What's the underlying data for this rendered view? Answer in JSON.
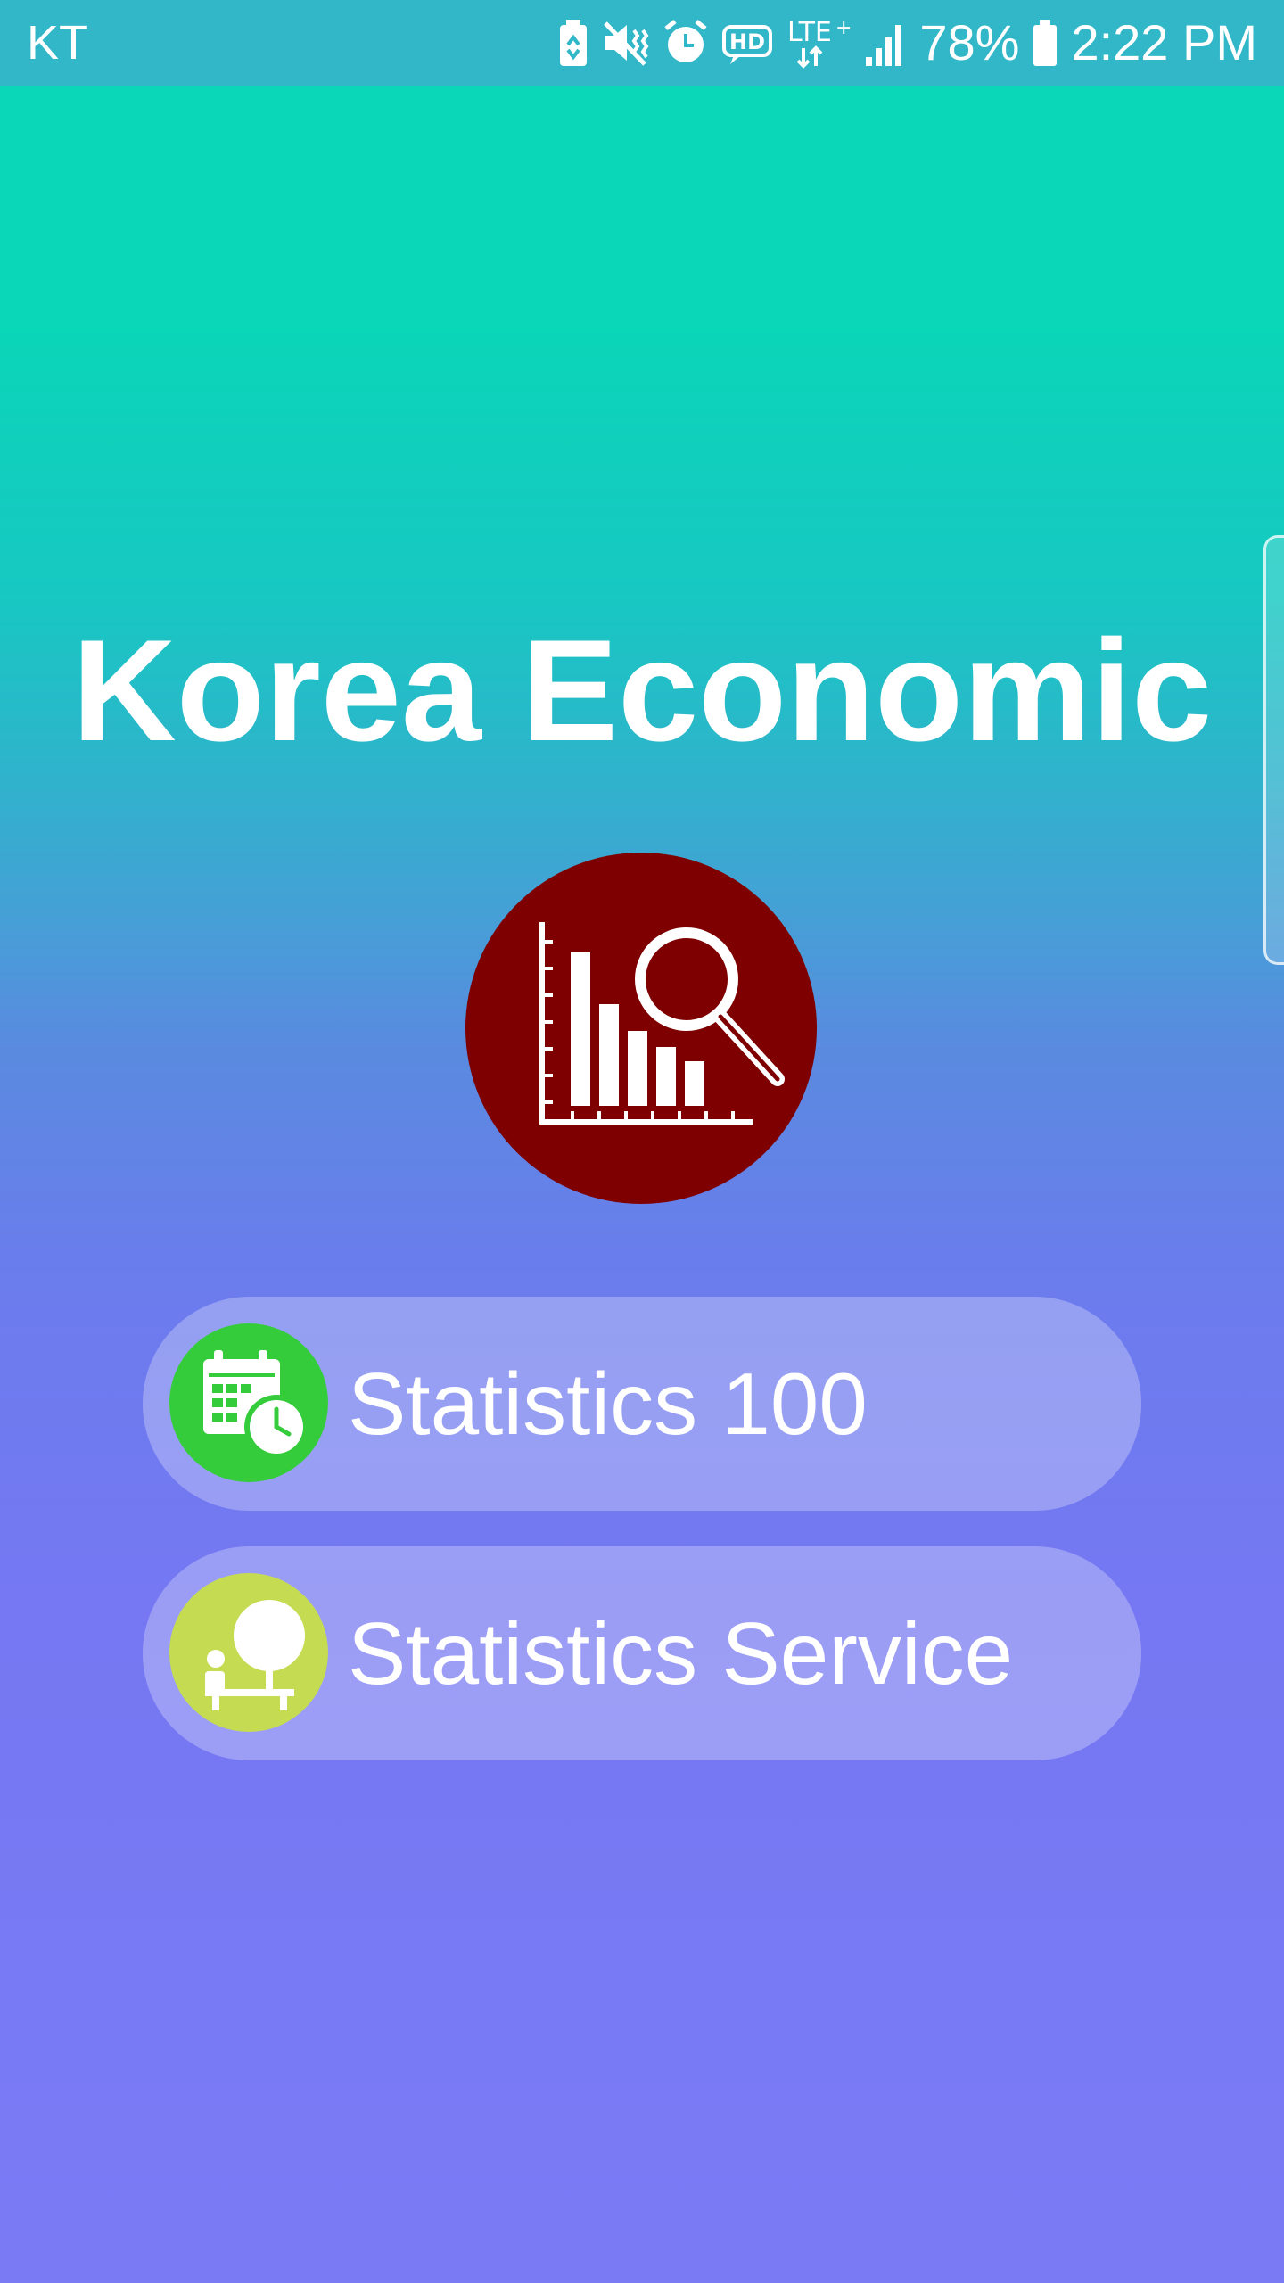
{
  "status_bar": {
    "carrier": "KT",
    "battery_percent": "78%",
    "time": "2:22 PM",
    "icons": [
      "battery-saver-icon",
      "vibrate-mute-icon",
      "alarm-icon",
      "hd-voice-icon",
      "lte-plus-icon",
      "signal-icon",
      "battery-icon"
    ],
    "lte_label": "LTE",
    "hd_label": "HD"
  },
  "app": {
    "title": "Korea Economic",
    "logo_icon": "chart-magnifier-icon"
  },
  "menu": {
    "items": [
      {
        "label": "Statistics 100",
        "icon": "calendar-clock-icon",
        "icon_color": "#35cc3c"
      },
      {
        "label": "Statistics Service",
        "icon": "person-tree-icon",
        "icon_color": "#c5dc52"
      }
    ]
  },
  "colors": {
    "status_bar": "#32b7c8",
    "gradient_top": "#0ad6b8",
    "gradient_bottom": "#7a7af5",
    "logo_background": "#7f0000"
  }
}
